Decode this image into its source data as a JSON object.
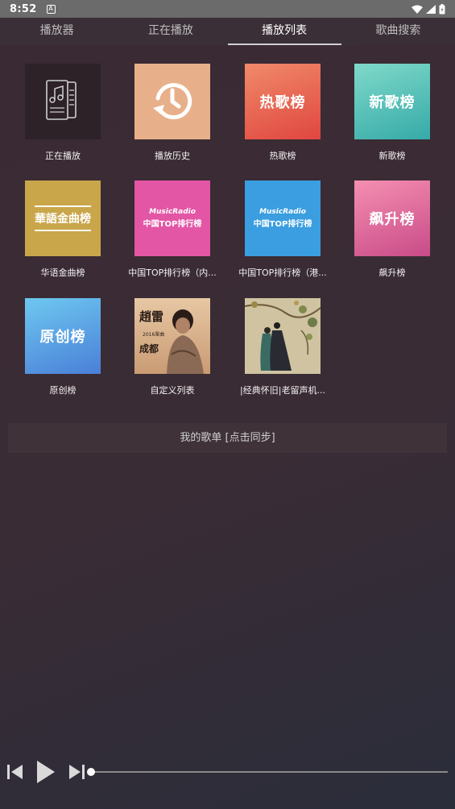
{
  "status": {
    "time": "8:52",
    "notification_glyph": "A"
  },
  "tabs": [
    {
      "label": "播放器"
    },
    {
      "label": "正在播放"
    },
    {
      "label": "播放列表"
    },
    {
      "label": "歌曲搜索"
    }
  ],
  "active_tab": 2,
  "playlists": [
    {
      "caption": "正在播放",
      "icon": "music-document-icon"
    },
    {
      "caption": "播放历史",
      "icon": "history-clock-icon"
    },
    {
      "caption": "热歌榜",
      "cover_text": "热歌榜"
    },
    {
      "caption": "新歌榜",
      "cover_text": "新歌榜"
    },
    {
      "caption": "华语金曲榜",
      "cover_text": "華語金曲榜"
    },
    {
      "caption": "中国TOP排行榜（内...",
      "cover_top": "MusicRadio",
      "cover_bottom": "中国TOP排行榜"
    },
    {
      "caption": "中国TOP排行榜（港...",
      "cover_top": "MusicRadio",
      "cover_bottom": "中国TOP排行榜"
    },
    {
      "caption": "飙升榜",
      "cover_text": "飙升榜"
    },
    {
      "caption": "原创榜",
      "cover_text": "原创榜"
    },
    {
      "caption": "自定义列表",
      "cover_text": "趙雷",
      "cover_sub": "2016單曲",
      "cover_sub2": "成都"
    },
    {
      "caption": "|经典怀旧|老留声机...",
      "icon": "painting-couple-icon"
    }
  ],
  "my_playlist": {
    "label": "我的歌单 [点击同步]"
  },
  "player": {
    "progress": 0.0
  },
  "colors": {
    "hot": "#e85a4f",
    "new": "#4fc3b8",
    "gold": "#c9a64a",
    "pink": "#e356a6",
    "blue": "#3a9ee0",
    "rise": "#d8609a",
    "original": "#4a8ed8",
    "history": "#e8b08a"
  }
}
